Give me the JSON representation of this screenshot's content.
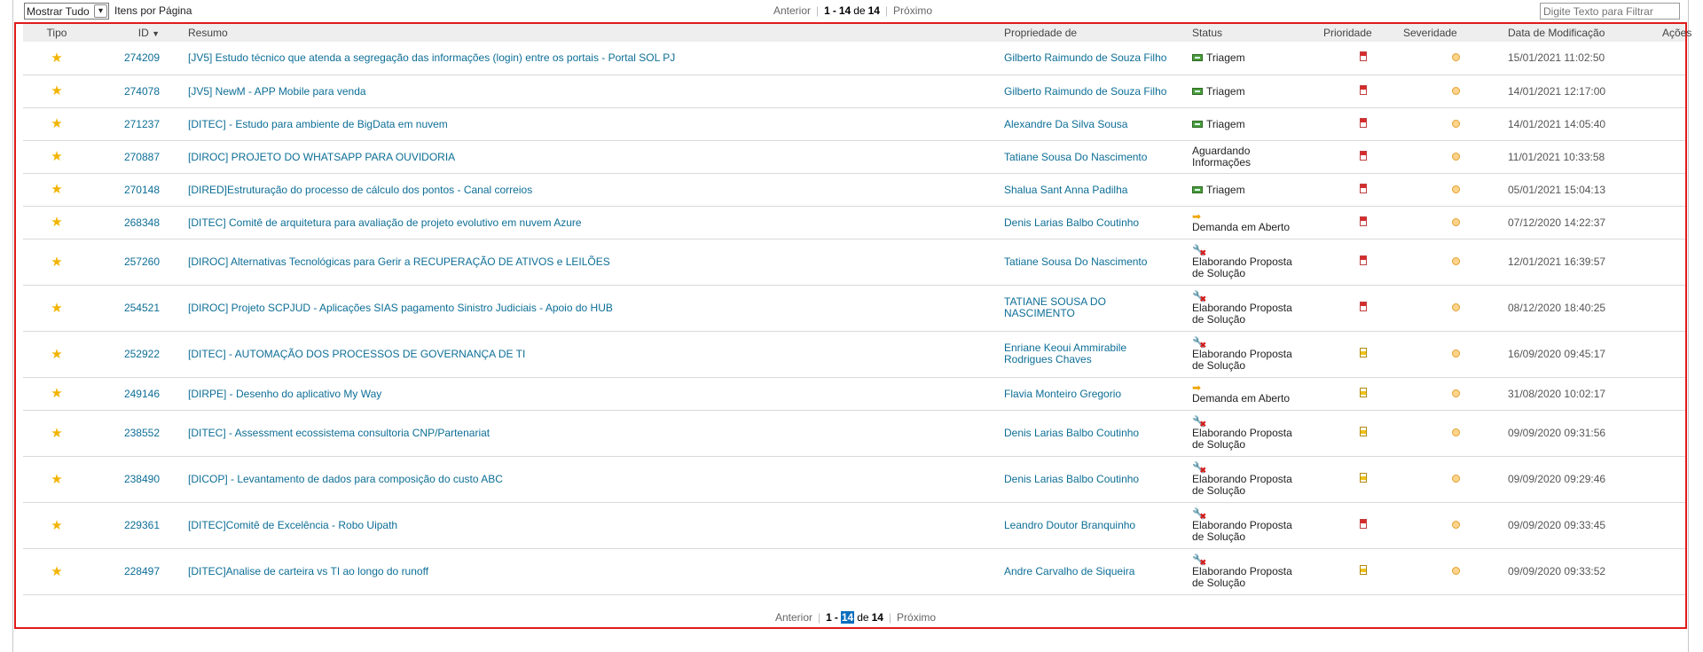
{
  "toolbar": {
    "page_size_select": "Mostrar Tudo",
    "per_page_label": "Itens por Página",
    "filter_placeholder": "Digite Texto para Filtrar"
  },
  "pager": {
    "prev": "Anterior",
    "range_start": "1",
    "dash": "-",
    "range_end": "14",
    "of": "de",
    "total": "14",
    "next": "Próximo"
  },
  "columns": {
    "tipo": "Tipo",
    "id": "ID",
    "resumo": "Resumo",
    "propriedade": "Propriedade de",
    "status": "Status",
    "prioridade": "Prioridade",
    "severidade": "Severidade",
    "data": "Data de Modificação",
    "acoes": "Ações"
  },
  "colors": {
    "frame": "#e01b1b",
    "link": "#0d6e96",
    "star": "#f2b400"
  },
  "rows": [
    {
      "id": "274209",
      "resumo": "[JV5] Estudo técnico que atenda a segregação das informações (login) entre os portais - Portal SOL PJ",
      "owner": "Gilberto Raimundo de Souza Filho",
      "status_icon": "triage-icon",
      "status": "Triagem",
      "prio": "high",
      "date": "15/01/2021 11:02:50"
    },
    {
      "id": "274078",
      "resumo": "[JV5] NewM - APP Mobile para venda",
      "owner": "Gilberto Raimundo de Souza Filho",
      "status_icon": "triage-icon",
      "status": "Triagem",
      "prio": "high",
      "date": "14/01/2021 12:17:00"
    },
    {
      "id": "271237",
      "resumo": "[DITEC] - Estudo para ambiente de BigData em nuvem",
      "owner": "Alexandre Da Silva Sousa",
      "status_icon": "triage-icon",
      "status": "Triagem",
      "prio": "high",
      "date": "14/01/2021 14:05:40"
    },
    {
      "id": "270887",
      "resumo": "[DIROC] PROJETO DO WHATSAPP PARA OUVIDORIA",
      "owner": "Tatiane Sousa Do Nascimento",
      "status_icon": "",
      "status": "Aguardando Informações",
      "prio": "high",
      "date": "11/01/2021 10:33:58"
    },
    {
      "id": "270148",
      "resumo": "[DIRED]Estruturação do processo de cálculo dos pontos - Canal correios",
      "owner": "Shalua Sant Anna Padilha",
      "status_icon": "triage-icon",
      "status": "Triagem",
      "prio": "high",
      "date": "05/01/2021 15:04:13"
    },
    {
      "id": "268348",
      "resumo": "[DITEC] Comitê de arquitetura para avaliação de projeto evolutivo em nuvem Azure",
      "owner": "Denis Larias Balbo Coutinho",
      "status_icon": "arrow-icon",
      "status": "Demanda em Aberto",
      "prio": "high",
      "date": "07/12/2020 14:22:37"
    },
    {
      "id": "257260",
      "resumo": "[DIROC] Alternativas Tecnológicas para Gerir a RECUPERAÇÃO DE ATIVOS e LEILÕES",
      "owner": "Tatiane Sousa Do Nascimento",
      "status_icon": "tools-icon",
      "status": "Elaborando Proposta de Solução",
      "prio": "high",
      "date": "12/01/2021 16:39:57"
    },
    {
      "id": "254521",
      "resumo": "[DIROC] Projeto SCPJUD - Aplicações SIAS pagamento Sinistro Judiciais - Apoio do HUB",
      "owner": "TATIANE SOUSA DO NASCIMENTO",
      "status_icon": "tools-icon",
      "status": "Elaborando Proposta de Solução",
      "prio": "high",
      "date": "08/12/2020 18:40:25"
    },
    {
      "id": "252922",
      "resumo": "[DITEC] - AUTOMAÇÃO DOS PROCESSOS DE GOVERNANÇA DE TI",
      "owner": "Enriane Keoui Ammirabile Rodrigues Chaves",
      "status_icon": "tools-icon",
      "status": "Elaborando Proposta de Solução",
      "prio": "medium",
      "date": "16/09/2020 09:45:17"
    },
    {
      "id": "249146",
      "resumo": "[DIRPE] - Desenho do aplicativo My Way",
      "owner": "Flavia Monteiro Gregorio",
      "status_icon": "arrow-icon",
      "status": "Demanda em Aberto",
      "prio": "medium",
      "date": "31/08/2020 10:02:17"
    },
    {
      "id": "238552",
      "resumo": "[DITEC] - Assessment ecossistema consultoria CNP/Partenariat",
      "owner": "Denis Larias Balbo Coutinho",
      "status_icon": "tools-icon",
      "status": "Elaborando Proposta de Solução",
      "prio": "medium",
      "date": "09/09/2020 09:31:56"
    },
    {
      "id": "238490",
      "resumo": "[DICOP] - Levantamento de dados para composição do custo ABC",
      "owner": "Denis Larias Balbo Coutinho",
      "status_icon": "tools-icon",
      "status": "Elaborando Proposta de Solução",
      "prio": "medium",
      "date": "09/09/2020 09:29:46"
    },
    {
      "id": "229361",
      "resumo": "[DITEC]Comitê de Excelência - Robo Uipath",
      "owner": "Leandro Doutor Branquinho",
      "status_icon": "tools-icon",
      "status": "Elaborando Proposta de Solução",
      "prio": "high",
      "date": "09/09/2020 09:33:45"
    },
    {
      "id": "228497",
      "resumo": "[DITEC]Analise de carteira vs TI ao longo do runoff",
      "owner": "Andre Carvalho de Siqueira",
      "status_icon": "tools-icon",
      "status": "Elaborando Proposta de Solução",
      "prio": "medium",
      "date": "09/09/2020 09:33:52"
    }
  ]
}
